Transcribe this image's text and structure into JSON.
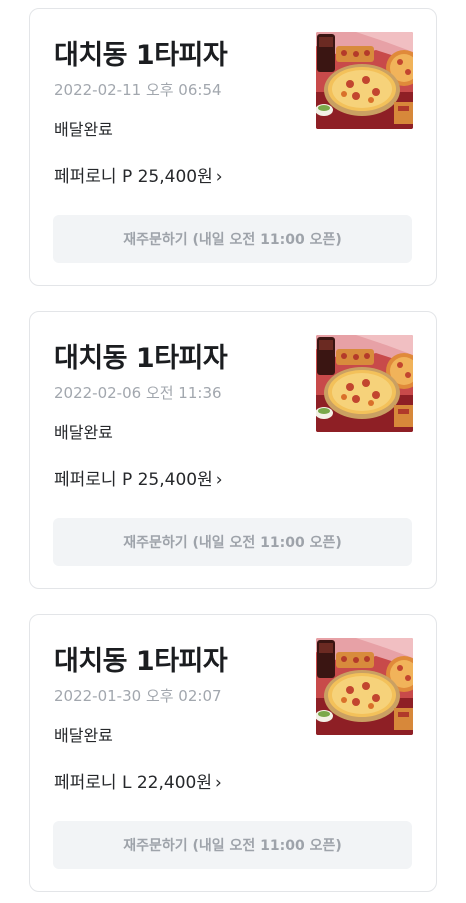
{
  "orders": [
    {
      "store_name": "대치동 1타피자",
      "order_time": "2022-02-11 오후 06:54",
      "status": "배달완료",
      "menu_summary": "페퍼로니 P 25,400원",
      "reorder_label": "재주문하기 (내일 오전 11:00 오픈)",
      "thumbnail_icon": "pizza-photo"
    },
    {
      "store_name": "대치동 1타피자",
      "order_time": "2022-02-06 오전 11:36",
      "status": "배달완료",
      "menu_summary": "페퍼로니 P 25,400원",
      "reorder_label": "재주문하기 (내일 오전 11:00 오픈)",
      "thumbnail_icon": "pizza-photo"
    },
    {
      "store_name": "대치동 1타피자",
      "order_time": "2022-01-30 오후 02:07",
      "status": "배달완료",
      "menu_summary": "페퍼로니 L 22,400원",
      "reorder_label": "재주문하기 (내일 오전 11:00 오픈)",
      "thumbnail_icon": "pizza-photo"
    }
  ],
  "chevron_glyph": "›",
  "colors": {
    "card_border": "#e3e5e8",
    "title_text": "#1b1d20",
    "muted_text": "#a2a7ae",
    "button_bg": "#f2f4f6",
    "button_text": "#9ea3aa"
  }
}
